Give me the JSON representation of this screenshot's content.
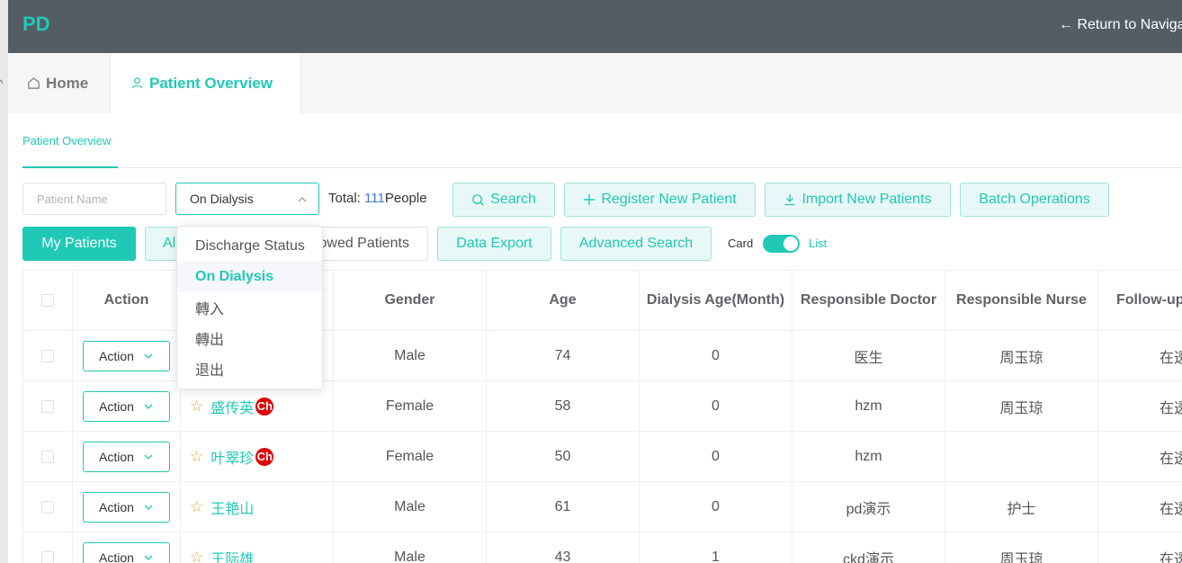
{
  "header": {
    "logo": "PD",
    "return_label": "← Return to Naviga"
  },
  "tabs": [
    {
      "label": "Home",
      "icon": "home-icon"
    },
    {
      "label": "Patient Overview",
      "icon": "user-icon"
    }
  ],
  "sub_tab": "Patient Overview",
  "filters": {
    "patient_name_placeholder": "Patient Name",
    "status_value": "On Dialysis",
    "total_label": "Total:",
    "total_count": "111",
    "total_unit": "People"
  },
  "toolbar": {
    "search": "Search",
    "register": "Register New Patient",
    "import": "Import New Patients",
    "batch": "Batch Operations",
    "my_patients": "My Patients",
    "all_prefix": "Al",
    "followed_suffix": "owed Patients",
    "data_export": "Data Export",
    "advanced_search": "Advanced Search",
    "card": "Card",
    "list": "List"
  },
  "dropdown": {
    "options": [
      "Discharge Status",
      "On Dialysis",
      "轉入",
      "轉出",
      "退出"
    ],
    "selected": "On Dialysis"
  },
  "table": {
    "headers": [
      "Action",
      "",
      "Gender",
      "Age",
      "Dialysis Age(Month)",
      "Responsible Doctor",
      "Responsible Nurse",
      "Follow-up"
    ],
    "action_label": "Action",
    "badge_text": "Ch",
    "rows": [
      {
        "name": "",
        "badge": false,
        "gender": "Male",
        "age": "74",
        "dialysis_age": "0",
        "doctor": "医生",
        "nurse": "周玉琼",
        "follow": "在透"
      },
      {
        "name": "盛传英",
        "badge": true,
        "gender": "Female",
        "age": "58",
        "dialysis_age": "0",
        "doctor": "hzm",
        "nurse": "周玉琼",
        "follow": "在透"
      },
      {
        "name": "叶翠珍",
        "badge": true,
        "gender": "Female",
        "age": "50",
        "dialysis_age": "0",
        "doctor": "hzm",
        "nurse": "",
        "follow": "在透"
      },
      {
        "name": "王艳山",
        "badge": false,
        "gender": "Male",
        "age": "61",
        "dialysis_age": "0",
        "doctor": "pd演示",
        "nurse": "护士",
        "follow": "在透"
      },
      {
        "name": "王际雄",
        "badge": false,
        "gender": "Male",
        "age": "43",
        "dialysis_age": "1",
        "doctor": "ckd演示",
        "nurse": "周玉琼",
        "follow": "在透"
      }
    ]
  },
  "colors": {
    "accent": "#20c9b6",
    "topbar": "#545c64",
    "star": "#e6a23c",
    "badge": "#e00000"
  }
}
